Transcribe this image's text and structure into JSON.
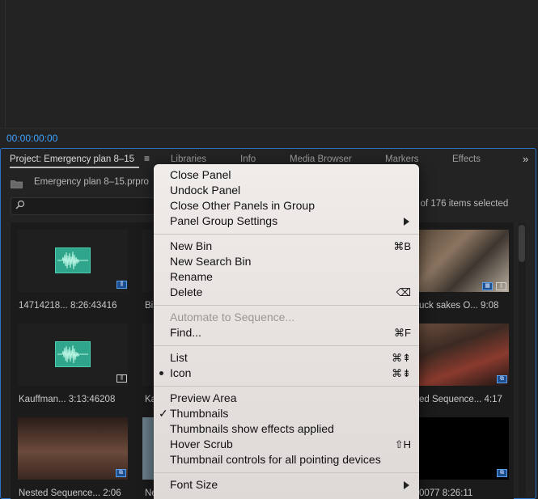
{
  "monitor": {
    "timecode": "00:00:00:00"
  },
  "tabs": [
    {
      "label": "Project: Emergency plan 8–15"
    },
    {
      "label": "Libraries"
    },
    {
      "label": "Info"
    },
    {
      "label": "Media Browser"
    },
    {
      "label": "Markers"
    },
    {
      "label": "Effects"
    }
  ],
  "project": {
    "name": "Emergency plan 8–15.prpro",
    "selected_count": "1 of 176 items selected",
    "search_placeholder": ""
  },
  "clips": [
    {
      "label": "14714218...  8:26:43416",
      "kind": "audio"
    },
    {
      "label": "Bi",
      "kind": "video"
    },
    {
      "label": "uck sakes O...    9:08",
      "kind": "video"
    },
    {
      "label": "Kauffman...   3:13:46208",
      "kind": "audio"
    },
    {
      "label": "Ka",
      "kind": "video"
    },
    {
      "label": "ed Sequence...   4:17",
      "kind": "video"
    },
    {
      "label": "Nested Sequence...   2:06",
      "kind": "video"
    },
    {
      "label": "Ne",
      "kind": "video"
    },
    {
      "label": "0077           8:26:11",
      "kind": "video"
    }
  ],
  "context_menu": {
    "items": [
      {
        "label": "Close Panel"
      },
      {
        "label": "Undock Panel"
      },
      {
        "label": "Close Other Panels in Group"
      },
      {
        "label": "Panel Group Settings",
        "submenu": true
      },
      {
        "label": "New Bin",
        "shortcut": "⌘B"
      },
      {
        "label": "New Search Bin"
      },
      {
        "label": "Rename"
      },
      {
        "label": "Delete",
        "shortcut": "⌫"
      },
      {
        "label": "Automate to Sequence...",
        "disabled": true
      },
      {
        "label": "Find...",
        "shortcut": "⌘F"
      },
      {
        "label": "List",
        "shortcut": "⌘⇞"
      },
      {
        "label": "Icon",
        "shortcut": "⌘⇟",
        "selected": true
      },
      {
        "label": "Preview Area"
      },
      {
        "label": "Thumbnails",
        "checked": true
      },
      {
        "label": "Thumbnails show effects applied"
      },
      {
        "label": "Hover Scrub",
        "shortcut": "⇧H"
      },
      {
        "label": "Thumbnail controls for all pointing devices"
      },
      {
        "label": "Font Size",
        "submenu": true
      }
    ]
  },
  "colors": {
    "accent": "#3ea1ff",
    "panel_border": "#2c73c8",
    "audio_clip": "#2fa58b"
  }
}
